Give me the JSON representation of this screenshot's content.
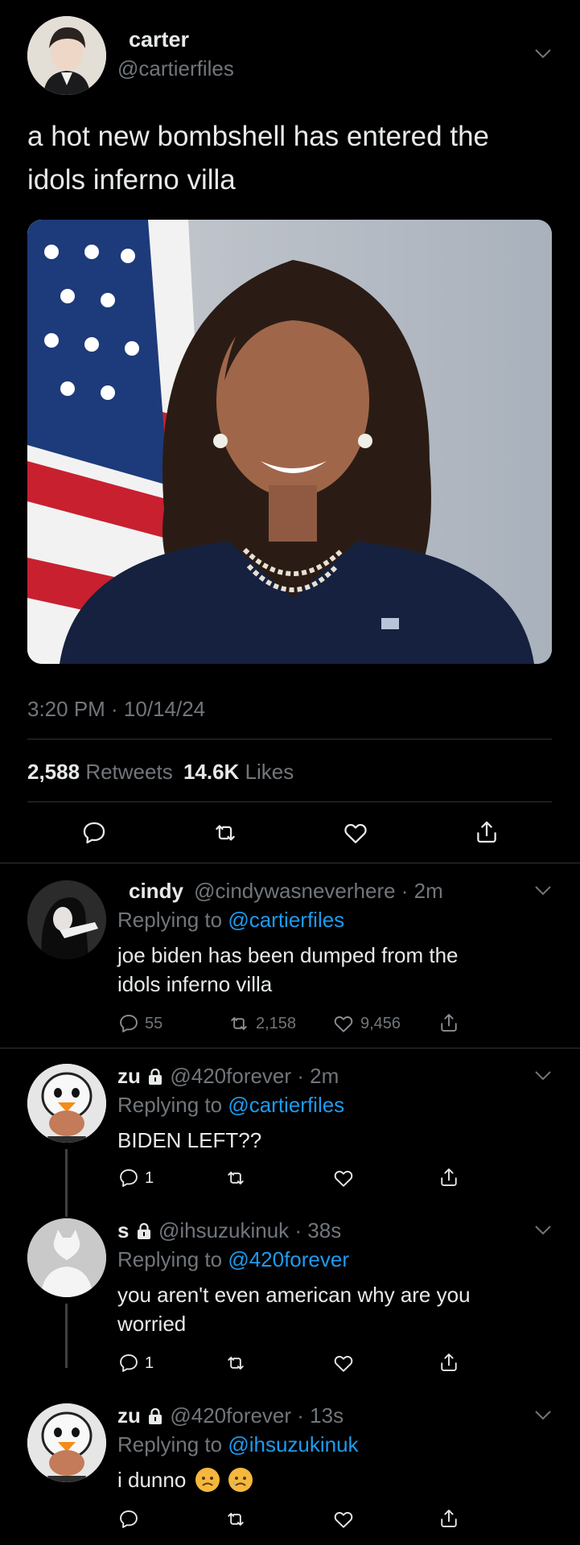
{
  "main_tweet": {
    "author_name": "carter",
    "author_handle": "@cartierfiles",
    "text_line1": "a hot new bombshell has entered the",
    "text_line2": "idols inferno villa",
    "timestamp": "3:20 PM · 10/14/24",
    "retweets_count": "2,588",
    "retweets_label": "Retweets",
    "likes_count": "14.6K",
    "likes_label": "Likes"
  },
  "replies": [
    {
      "name": "cindy",
      "handle_time": "@cindywasneverhere · 2m",
      "replying_prefix": "Replying to",
      "replying_to": "@cartierfiles",
      "text_line1": "joe biden has been dumped from the",
      "text_line2": "idols inferno villa",
      "replies": "55",
      "retweets": "2,158",
      "likes": "9,456"
    },
    {
      "name": "zu",
      "handle_time": "@420forever · 2m",
      "replying_prefix": "Replying to",
      "replying_to": "@cartierfiles",
      "text_line1": "BIDEN LEFT??",
      "replies": "1"
    },
    {
      "name": "s",
      "handle_time": "@ihsuzukinuk · 38s",
      "replying_prefix": "Replying to",
      "replying_to": "@420forever",
      "text_line1": "you aren't even american why are you",
      "text_line2": "worried",
      "replies": "1"
    },
    {
      "name": "zu",
      "handle_time": "@420forever · 13s",
      "replying_prefix": "Replying to",
      "replying_to": "@ihsuzukinuk",
      "text_line1": "i dunno"
    }
  ],
  "colors": {
    "background": "#000000",
    "text": "#e7e9ea",
    "secondary": "#71767b",
    "link": "#1d9bf0",
    "divider": "#2f3336"
  },
  "icons": [
    "chevron-down-icon",
    "reply-icon",
    "retweet-icon",
    "like-icon",
    "share-icon",
    "lock-icon",
    "sad-emoji-icon"
  ]
}
